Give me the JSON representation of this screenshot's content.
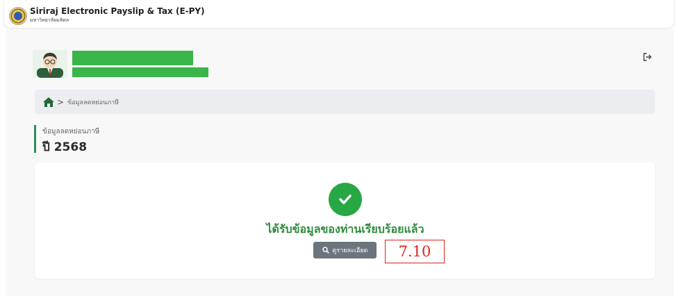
{
  "header": {
    "title": "Siriraj Electronic Payslip & Tax (E-PY)",
    "subtitle": "มหาวิทยาลัยมหิดล",
    "logo_icon": "university-seal-icon"
  },
  "profile": {
    "avatar_icon": "user-avatar-icon",
    "name_redacted_color": "#39b54a",
    "logout_icon": "logout-icon"
  },
  "breadcrumb": {
    "home_icon": "home-icon",
    "separator": ">",
    "current": "ข้อมูลลดหย่อนภาษี"
  },
  "section": {
    "title": "ข้อมูลลดหย่อนภาษี",
    "year_label": "ปี 2568"
  },
  "result": {
    "status_icon": "check-circle-icon",
    "message": "ได้รับข้อมูลของท่านเรียบร้อยแล้ว",
    "detail_button": "ดูรายละเอียด",
    "detail_icon": "search-icon"
  },
  "annotation": {
    "label": "7.10"
  },
  "colors": {
    "accent_green": "#2e8b3d",
    "success": "#28a745",
    "button_gray": "#6c757d",
    "annotation_red": "#e0201c"
  }
}
